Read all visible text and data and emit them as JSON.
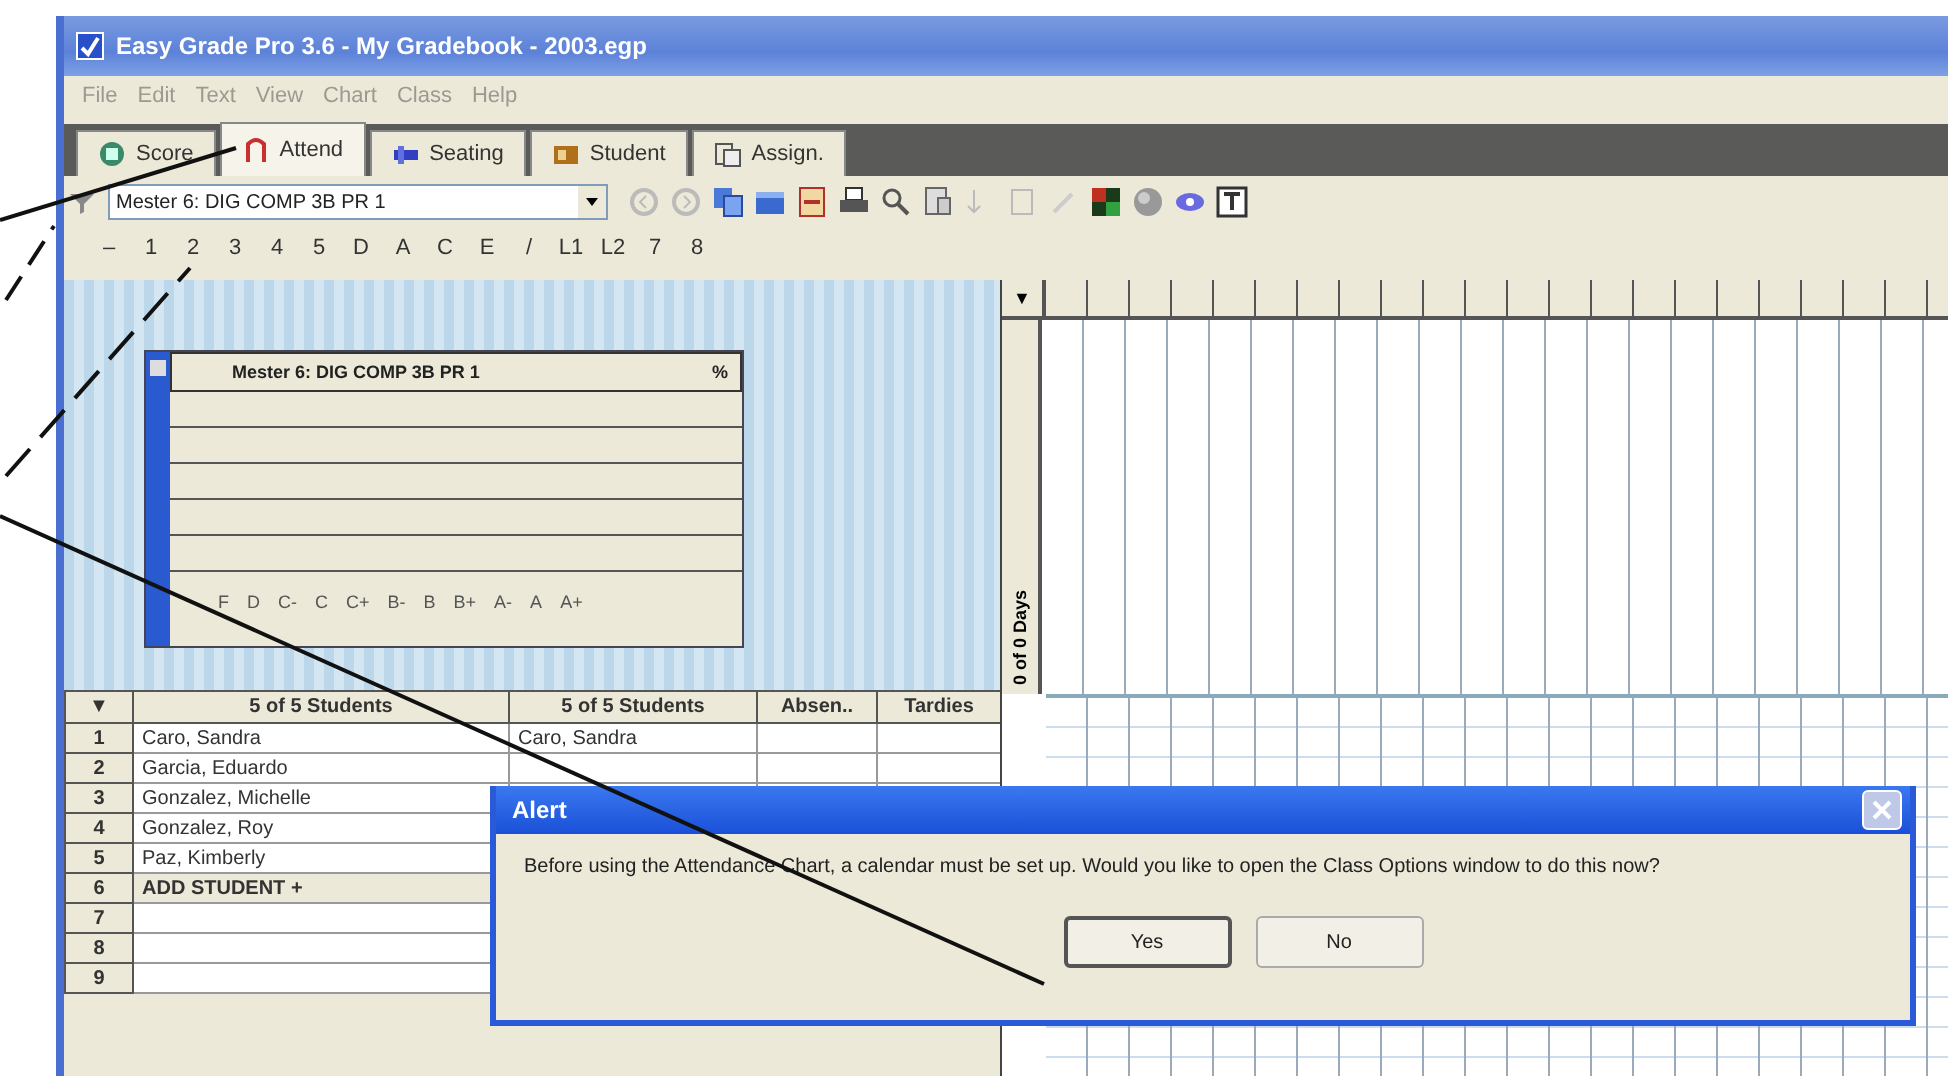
{
  "window": {
    "title": "Easy Grade Pro 3.6 - My Gradebook - 2003.egp"
  },
  "menu": [
    "File",
    "Edit",
    "Text",
    "View",
    "Chart",
    "Class",
    "Help"
  ],
  "tabs": [
    {
      "label": "Score",
      "selected": false
    },
    {
      "label": "Attend",
      "selected": true
    },
    {
      "label": "Seating",
      "selected": false
    },
    {
      "label": "Student",
      "selected": false
    },
    {
      "label": "Assign.",
      "selected": false
    }
  ],
  "toolbar": {
    "class_select": {
      "value": "Mester 6: DIG COMP 3B PR 1"
    }
  },
  "column_keys": [
    "–",
    "1",
    "2",
    "3",
    "4",
    "5",
    "D",
    "A",
    "C",
    "E",
    "/",
    "L1",
    "L2",
    "7",
    "8"
  ],
  "summary_chart": {
    "title": "Mester 6: DIG COMP 3B PR 1",
    "unit": "%",
    "grades": [
      "F",
      "D",
      "C-",
      "C",
      "C+",
      "B-",
      "B",
      "B+",
      "A-",
      "A",
      "A+"
    ]
  },
  "calendar": {
    "sort_arrow": "▼",
    "days_label": "0 of 0 Days"
  },
  "roster": {
    "columns": [
      "▼",
      "5 of 5 Students",
      "5 of 5 Students",
      "Absen..",
      "Tardies"
    ],
    "rows": [
      {
        "number": "1",
        "name": "Caro, Sandra",
        "name_2": "Caro, Sandra"
      },
      {
        "number": "2",
        "name": "Garcia, Eduardo"
      },
      {
        "number": "3",
        "name": "Gonzalez, Michelle"
      },
      {
        "number": "4",
        "name": "Gonzalez, Roy"
      },
      {
        "number": "5",
        "name": "Paz, Kimberly"
      },
      {
        "number": "6",
        "name": "ADD STUDENT +",
        "kind": "add"
      },
      {
        "number": "7"
      },
      {
        "number": "8"
      },
      {
        "number": "9"
      }
    ]
  },
  "dialog": {
    "title": "Alert",
    "message": "Before using the Attendance Chart, a calendar must be set up. Would you like to open the Class Options window to do this now?",
    "buttons": [
      {
        "label": "Yes",
        "default": true
      },
      {
        "label": "No",
        "default": false
      }
    ]
  }
}
